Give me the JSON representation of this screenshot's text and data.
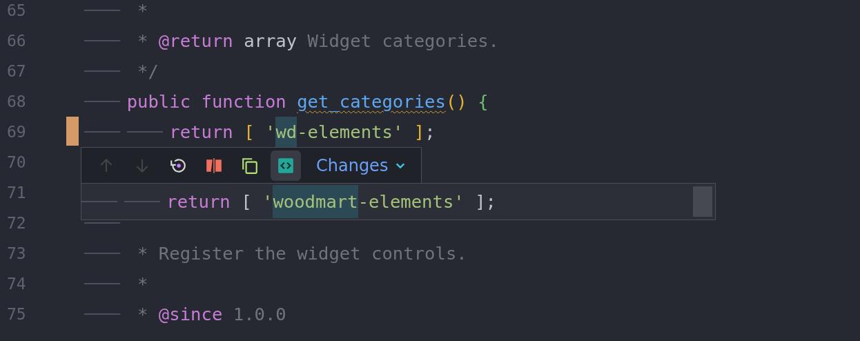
{
  "editor": {
    "lines": [
      {
        "number": "65",
        "changed": false,
        "code": [
          {
            "kind": "tab"
          },
          {
            "kind": "comment",
            "text": " *"
          }
        ]
      },
      {
        "number": "66",
        "changed": false,
        "code": [
          {
            "kind": "tab"
          },
          {
            "kind": "comment",
            "text": " * "
          },
          {
            "kind": "doc-tag",
            "text": "@return"
          },
          {
            "kind": "plain",
            "text": " array"
          },
          {
            "kind": "comment",
            "text": " Widget categories."
          }
        ]
      },
      {
        "number": "67",
        "changed": false,
        "code": [
          {
            "kind": "tab"
          },
          {
            "kind": "comment",
            "text": " */"
          }
        ]
      },
      {
        "number": "68",
        "changed": false,
        "code": [
          {
            "kind": "tab"
          },
          {
            "kind": "keyword",
            "text": "public function "
          },
          {
            "kind": "function-warning",
            "text": "get_categories"
          },
          {
            "kind": "paren",
            "text": "()"
          },
          {
            "kind": "brace",
            "text": " {"
          }
        ]
      },
      {
        "number": "69",
        "changed": true,
        "code": [
          {
            "kind": "tab"
          },
          {
            "kind": "tab"
          },
          {
            "kind": "keyword",
            "text": "return "
          },
          {
            "kind": "paren",
            "text": "[ "
          },
          {
            "kind": "string",
            "text": "'"
          },
          {
            "kind": "changed",
            "text": "wd"
          },
          {
            "kind": "string",
            "text": "-elements' "
          },
          {
            "kind": "paren",
            "text": "]"
          },
          {
            "kind": "plain",
            "text": ";"
          }
        ]
      },
      {
        "number": "70",
        "changed": false
      },
      {
        "number": "71",
        "changed": false
      },
      {
        "number": "72",
        "changed": false,
        "code": [
          {
            "kind": "tab"
          }
        ]
      },
      {
        "number": "73",
        "changed": false,
        "code": [
          {
            "kind": "tab"
          },
          {
            "kind": "comment",
            "text": " * Register the widget controls."
          }
        ]
      },
      {
        "number": "74",
        "changed": false,
        "code": [
          {
            "kind": "tab"
          },
          {
            "kind": "comment",
            "text": " *"
          }
        ]
      },
      {
        "number": "75",
        "changed": false,
        "code": [
          {
            "kind": "tab"
          },
          {
            "kind": "comment",
            "text": " * "
          },
          {
            "kind": "doc-tag",
            "text": "@since"
          },
          {
            "kind": "comment",
            "text": " 1.0.0"
          }
        ]
      }
    ]
  },
  "diff_popup": {
    "buttons": [
      {
        "kind": "up",
        "disabled": true,
        "selected": false
      },
      {
        "kind": "down",
        "disabled": true,
        "selected": false
      },
      {
        "kind": "revert",
        "disabled": false,
        "selected": false
      },
      {
        "kind": "compare",
        "disabled": false,
        "selected": false
      },
      {
        "kind": "copy",
        "disabled": false,
        "selected": false
      },
      {
        "kind": "code",
        "disabled": false,
        "selected": true
      }
    ],
    "dropdown": {
      "label": "Changes"
    },
    "previous_code": [
      {
        "kind": "tab"
      },
      {
        "kind": "tab"
      },
      {
        "kind": "keyword",
        "text": "return "
      },
      {
        "kind": "plain",
        "text": "[ "
      },
      {
        "kind": "string",
        "text": "'"
      },
      {
        "kind": "changed",
        "text": "woodmart"
      },
      {
        "kind": "string",
        "text": "-elements'"
      },
      {
        "kind": "plain",
        "text": " ];"
      }
    ]
  }
}
